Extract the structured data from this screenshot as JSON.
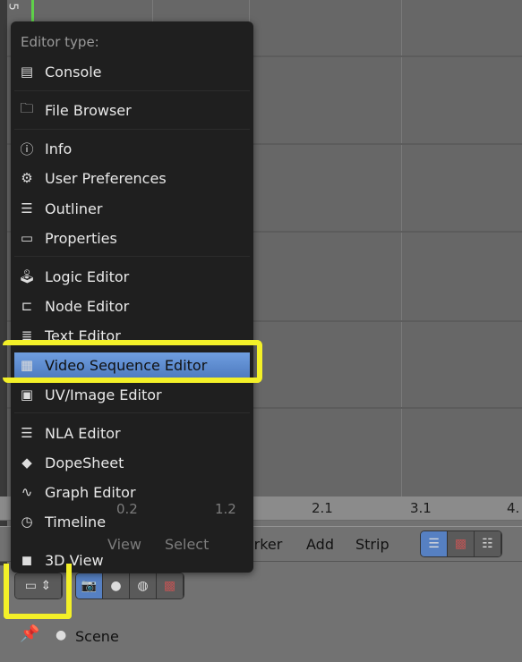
{
  "menu": {
    "title": "Editor type:",
    "items": [
      {
        "label": "Console",
        "icon": "console-icon",
        "glyph": "▤"
      },
      {
        "label": "File Browser",
        "icon": "folder-icon",
        "glyph": "🗀"
      },
      {
        "label": "Info",
        "icon": "info-icon",
        "glyph": "ⓘ"
      },
      {
        "label": "User Preferences",
        "icon": "preferences-icon",
        "glyph": "⚙"
      },
      {
        "label": "Outliner",
        "icon": "outliner-icon",
        "glyph": "☰"
      },
      {
        "label": "Properties",
        "icon": "properties-icon",
        "glyph": "▭"
      },
      {
        "label": "Logic Editor",
        "icon": "logic-icon",
        "glyph": "🕹"
      },
      {
        "label": "Node Editor",
        "icon": "node-icon",
        "glyph": "⊏"
      },
      {
        "label": "Text Editor",
        "icon": "text-icon",
        "glyph": "≣"
      },
      {
        "label": "Video Sequence Editor",
        "icon": "sequencer-icon",
        "glyph": "▦",
        "selected": true
      },
      {
        "label": "UV/Image Editor",
        "icon": "image-icon",
        "glyph": "▣"
      },
      {
        "label": "NLA Editor",
        "icon": "nla-icon",
        "glyph": "☰"
      },
      {
        "label": "DopeSheet",
        "icon": "dopesheet-icon",
        "glyph": "◆"
      },
      {
        "label": "Graph Editor",
        "icon": "graph-icon",
        "glyph": "∿"
      },
      {
        "label": "Timeline",
        "icon": "clock-icon",
        "glyph": "◷"
      },
      {
        "label": "3D View",
        "icon": "cube-icon",
        "glyph": "◼"
      }
    ]
  },
  "ruler": {
    "ticks": [
      "0.2",
      "1.2",
      "2.1",
      "3.1",
      "4."
    ]
  },
  "header": {
    "menus": [
      "View",
      "Select",
      "Marker",
      "Add",
      "Strip"
    ]
  },
  "side_label": "5",
  "properties": {
    "scene_label": "Scene"
  },
  "colors": {
    "highlight": "#f3f028",
    "selected": "#5f8dd3"
  }
}
